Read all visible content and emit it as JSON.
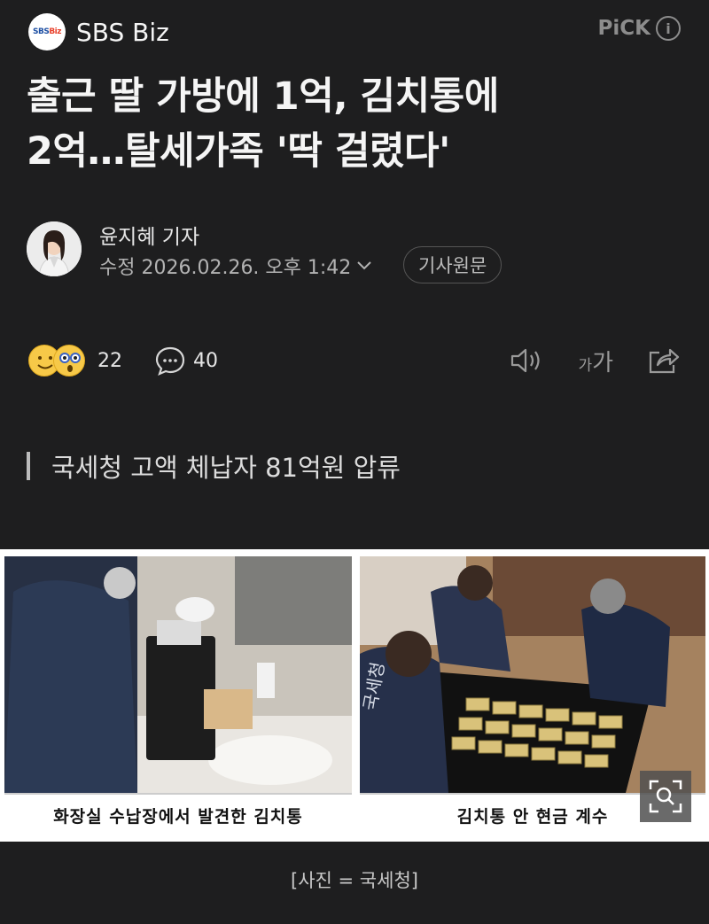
{
  "header": {
    "logo_text_sbs": "SBS",
    "logo_text_biz": "Biz",
    "press_name": "SBS Biz",
    "pick_label": "PiCK",
    "info_symbol": "i"
  },
  "article": {
    "title_line1": "출근 딸 가방에 1억, 김치통에",
    "title_line2": "2억…탈세가족 '딱 걸렸다'",
    "author": "윤지혜 기자",
    "date": "수정 2026.02.26. 오후 1:42",
    "original_button": "기사원문",
    "reaction_count": "22",
    "comment_count": "40",
    "fontsize_small": "가",
    "fontsize_large": "가",
    "subheading": "국세청 고액 체납자 81억원 압류"
  },
  "photo": {
    "left_caption": "화장실 수납장에서 발견한 김치통",
    "right_caption": "김치통 안 현금 계수",
    "credit": "[사진 = 국세청]",
    "vest_text": "국세청"
  },
  "colors": {
    "background": "#1e1e1f",
    "text": "#f5f5f5",
    "muted": "#9a9a9a",
    "emoji_yellow": "#f7c948"
  }
}
